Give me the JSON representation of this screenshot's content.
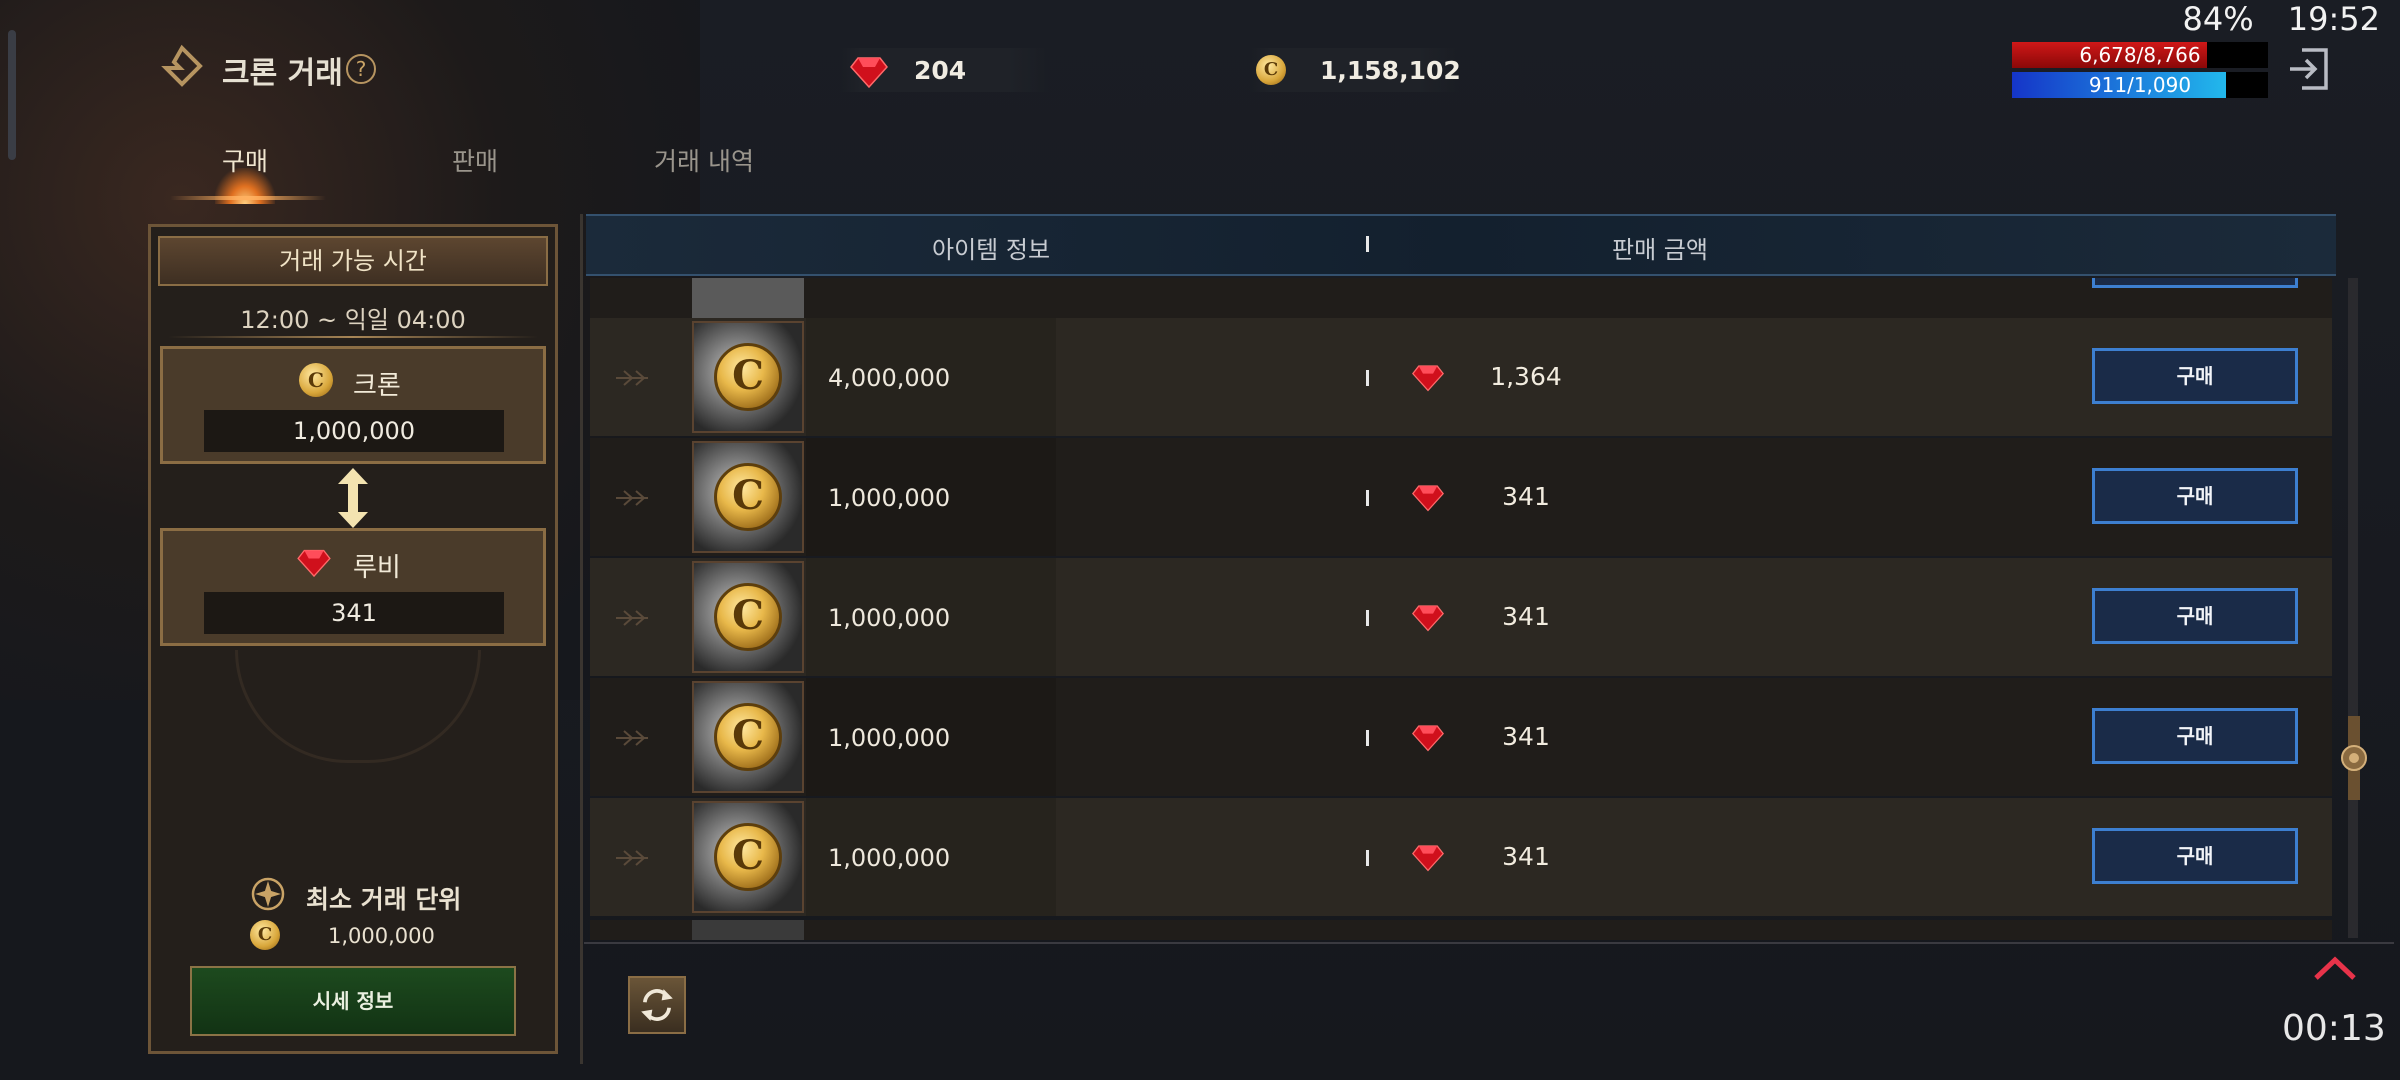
{
  "status_bar": {
    "battery": "84%",
    "time": "19:52"
  },
  "header": {
    "title": "크론 거래",
    "help_symbol": "?",
    "ruby_amount": "204",
    "coin_amount": "1,158,102",
    "hp_text": "6,678/8,766",
    "hp_fraction": 0.762,
    "mp_text": "911/1,090",
    "mp_fraction": 0.836,
    "colors": {
      "hp": "#b01010",
      "mp": "#1aa8e0",
      "accent": "#c9a366"
    }
  },
  "tabs": [
    {
      "label": "구매",
      "active": true
    },
    {
      "label": "판매",
      "active": false
    },
    {
      "label": "거래 내역",
      "active": false
    }
  ],
  "left_panel": {
    "header": "거래 가능 시간",
    "time_range": "12:00 ~ 익일 04:00",
    "from": {
      "label": "크론",
      "value": "1,000,000"
    },
    "to": {
      "label": "루비",
      "value": "341"
    },
    "min_unit_label": "최소 거래 단위",
    "min_unit_value": "1,000,000",
    "market_button": "시세 정보"
  },
  "table": {
    "col_item": "아이템 정보",
    "col_price": "판매 금액",
    "coin_symbol": "C",
    "buy_label": "구매",
    "rows": [
      {
        "qty": "4,000,000",
        "price": "1,364"
      },
      {
        "qty": "1,000,000",
        "price": "341"
      },
      {
        "qty": "1,000,000",
        "price": "341"
      },
      {
        "qty": "1,000,000",
        "price": "341"
      },
      {
        "qty": "1,000,000",
        "price": "341"
      }
    ]
  },
  "footer": {
    "timer": "00:13"
  }
}
